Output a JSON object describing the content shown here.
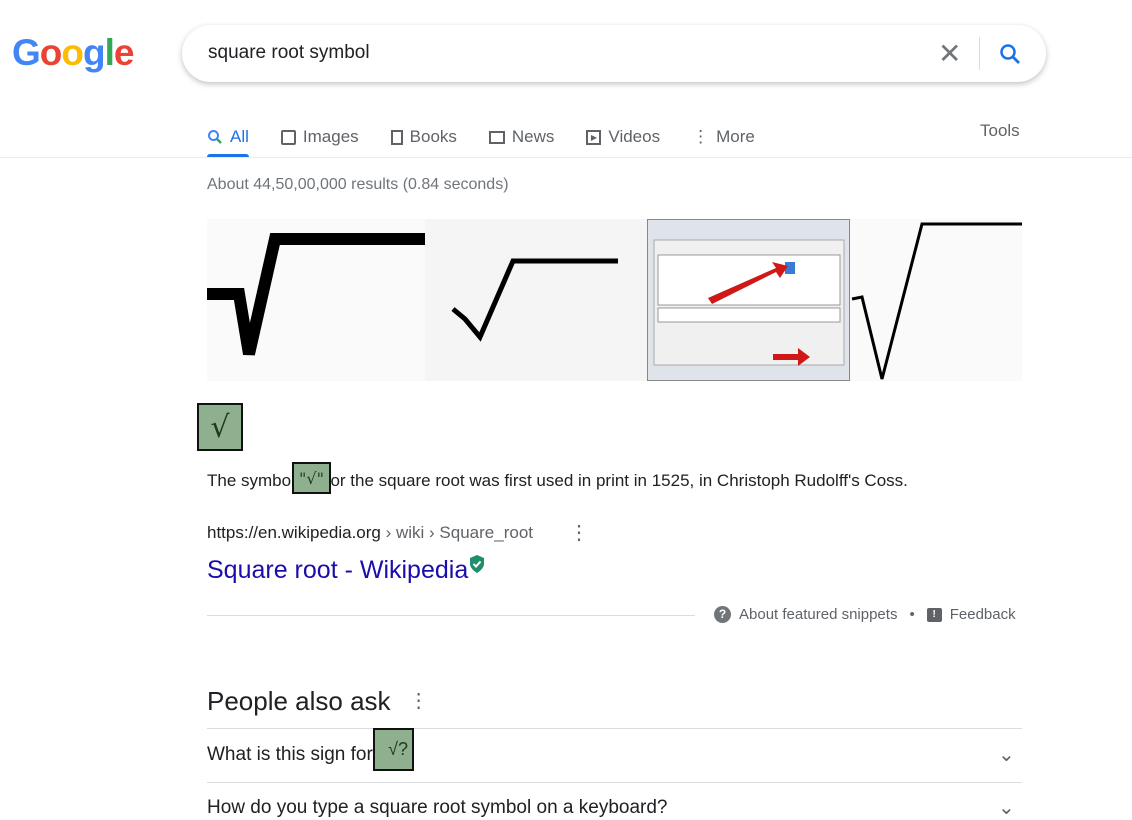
{
  "logo": {
    "text": "Google",
    "colors": [
      "#4285f4",
      "#ea4335",
      "#fbbc05",
      "#4285f4",
      "#34a853",
      "#ea4335"
    ]
  },
  "search": {
    "query": "square root symbol",
    "clear_icon": "close-icon",
    "search_icon": "search-icon"
  },
  "tabs": [
    {
      "label": "All",
      "icon": "search-icon",
      "active": true
    },
    {
      "label": "Images",
      "icon": "image-icon"
    },
    {
      "label": "Books",
      "icon": "book-icon"
    },
    {
      "label": "News",
      "icon": "news-icon"
    },
    {
      "label": "Videos",
      "icon": "play-icon"
    },
    {
      "label": "More",
      "icon": "more-vert-icon"
    }
  ],
  "tools_label": "Tools",
  "stats": "About 44,50,00,000 results (0.84 seconds)",
  "snippet": {
    "answer": "√",
    "text_before": "The symbol ",
    "quoted": "\"√\"",
    "text_after": " for the square root was first used in print in 1525, in Christoph Rudolff's Coss.",
    "cite_domain": "https://en.wikipedia.org",
    "cite_path": " › wiki › Square_root",
    "title": "Square root - Wikipedia",
    "about": "About featured snippets",
    "feedback": "Feedback",
    "dot": "•"
  },
  "paa": {
    "heading": "People also ask",
    "questions": [
      "What is this sign for √?",
      "How do you type a square root symbol on a keyboard?"
    ]
  }
}
